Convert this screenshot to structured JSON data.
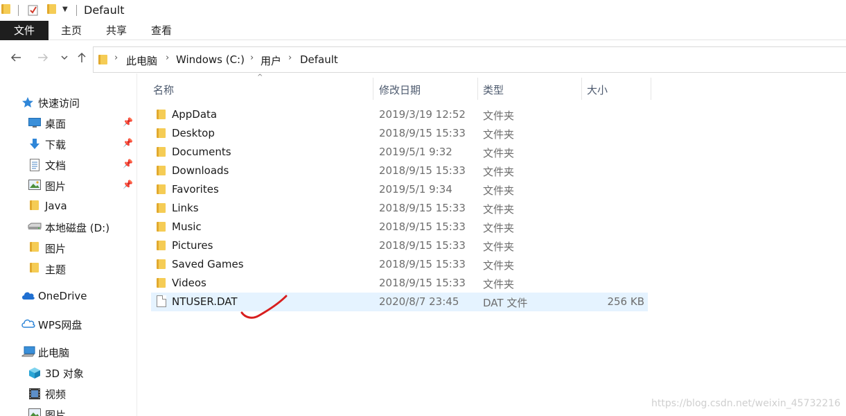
{
  "window": {
    "title": "Default"
  },
  "ribbon": {
    "tabs": [
      {
        "label": "文件",
        "active": true
      },
      {
        "label": "主页"
      },
      {
        "label": "共享"
      },
      {
        "label": "查看"
      }
    ]
  },
  "breadcrumb": [
    "此电脑",
    "Windows (C:)",
    "用户",
    "Default"
  ],
  "sidebar": {
    "items": [
      {
        "label": "快速访问",
        "icon": "star-icon"
      },
      {
        "label": "桌面",
        "icon": "desktop-icon",
        "pinned": true
      },
      {
        "label": "下载",
        "icon": "download-icon",
        "pinned": true
      },
      {
        "label": "文档",
        "icon": "document-icon",
        "pinned": true
      },
      {
        "label": "图片",
        "icon": "picture-icon",
        "pinned": true
      },
      {
        "label": "Java",
        "icon": "folder-icon"
      },
      {
        "label": "本地磁盘 (D:)",
        "icon": "drive-icon"
      },
      {
        "label": "图片",
        "icon": "folder-icon"
      },
      {
        "label": "主题",
        "icon": "folder-icon"
      },
      {
        "label": "OneDrive",
        "icon": "cloud-icon"
      },
      {
        "label": "WPS网盘",
        "icon": "cloud-outline-icon"
      },
      {
        "label": "此电脑",
        "icon": "computer-icon"
      },
      {
        "label": "3D 对象",
        "icon": "cube-icon"
      },
      {
        "label": "视频",
        "icon": "video-icon"
      },
      {
        "label": "图片",
        "icon": "picture-icon"
      }
    ]
  },
  "columns": {
    "name": "名称",
    "date": "修改日期",
    "type": "类型",
    "size": "大小"
  },
  "files": [
    {
      "name": "AppData",
      "date": "2019/3/19 12:52",
      "type": "文件夹",
      "size": "",
      "kind": "folder"
    },
    {
      "name": "Desktop",
      "date": "2018/9/15 15:33",
      "type": "文件夹",
      "size": "",
      "kind": "folder"
    },
    {
      "name": "Documents",
      "date": "2019/5/1 9:32",
      "type": "文件夹",
      "size": "",
      "kind": "folder"
    },
    {
      "name": "Downloads",
      "date": "2018/9/15 15:33",
      "type": "文件夹",
      "size": "",
      "kind": "folder"
    },
    {
      "name": "Favorites",
      "date": "2019/5/1 9:34",
      "type": "文件夹",
      "size": "",
      "kind": "folder"
    },
    {
      "name": "Links",
      "date": "2018/9/15 15:33",
      "type": "文件夹",
      "size": "",
      "kind": "folder"
    },
    {
      "name": "Music",
      "date": "2018/9/15 15:33",
      "type": "文件夹",
      "size": "",
      "kind": "folder"
    },
    {
      "name": "Pictures",
      "date": "2018/9/15 15:33",
      "type": "文件夹",
      "size": "",
      "kind": "folder"
    },
    {
      "name": "Saved Games",
      "date": "2018/9/15 15:33",
      "type": "文件夹",
      "size": "",
      "kind": "folder"
    },
    {
      "name": "Videos",
      "date": "2018/9/15 15:33",
      "type": "文件夹",
      "size": "",
      "kind": "folder"
    },
    {
      "name": "NTUSER.DAT",
      "date": "2020/8/7 23:45",
      "type": "DAT 文件",
      "size": "256 KB",
      "kind": "file",
      "selected": true
    }
  ],
  "watermark": "https://blog.csdn.net/weixin_45732216",
  "colors": {
    "accent": "#1e1e1e",
    "selection": "#e5f3ff",
    "folder": "#f5cc55",
    "annotation": "#d81e1e"
  }
}
